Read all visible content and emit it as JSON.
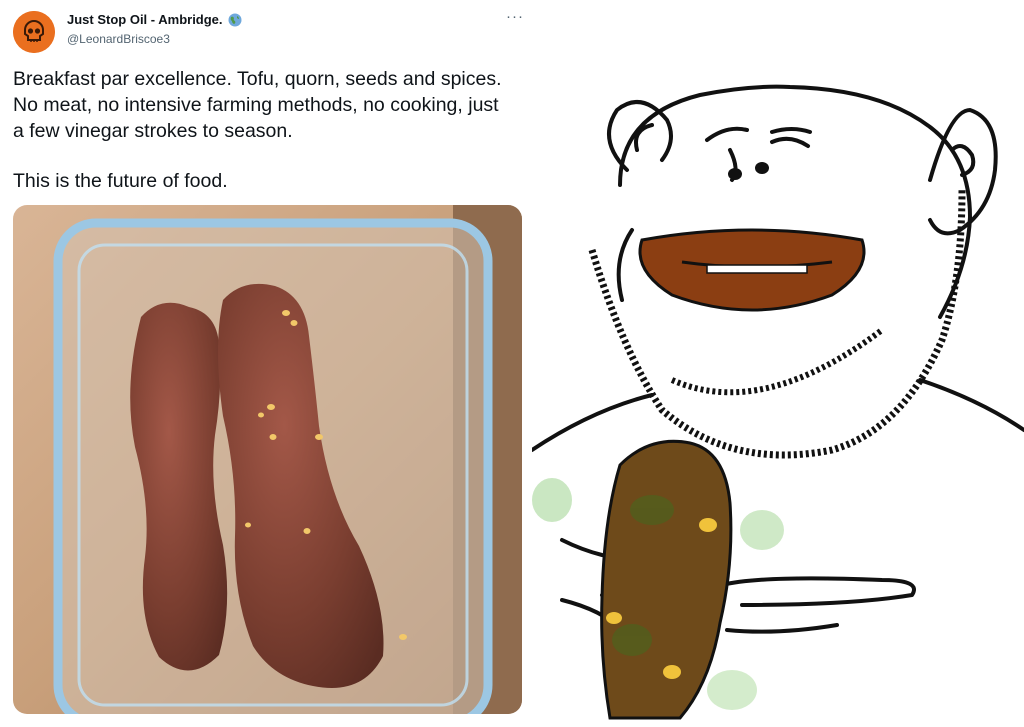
{
  "tweet": {
    "author": {
      "display_name": "Just Stop Oil - Ambridge.",
      "handle": "@LeonardBriscoe3",
      "avatar_icon": "skull-icon",
      "avatar_color": "#ea6f1f",
      "badge_icon": "globe-icon"
    },
    "menu_icon": "more-options-icon",
    "menu_label": "···",
    "text": {
      "paragraph_1": "Breakfast par excellence. Tofu, quorn, seeds and spices. No meat, no intensive farming methods, no cooking, just a few vinegar strokes to season.",
      "paragraph_2": "This is the future of food."
    },
    "media": {
      "kind": "photo",
      "subject": "two brown log-shaped food items in a glass container"
    }
  },
  "meme": {
    "kind": "cartoon-drawing",
    "subject": "grinning bearded character holding a brown log-shaped item"
  },
  "colors": {
    "text": "#0f1419",
    "secondary_text": "#536471",
    "food_brown": "#7a3e30",
    "lips_brown": "#8b3e12",
    "table_wood": "#c89f7a"
  }
}
